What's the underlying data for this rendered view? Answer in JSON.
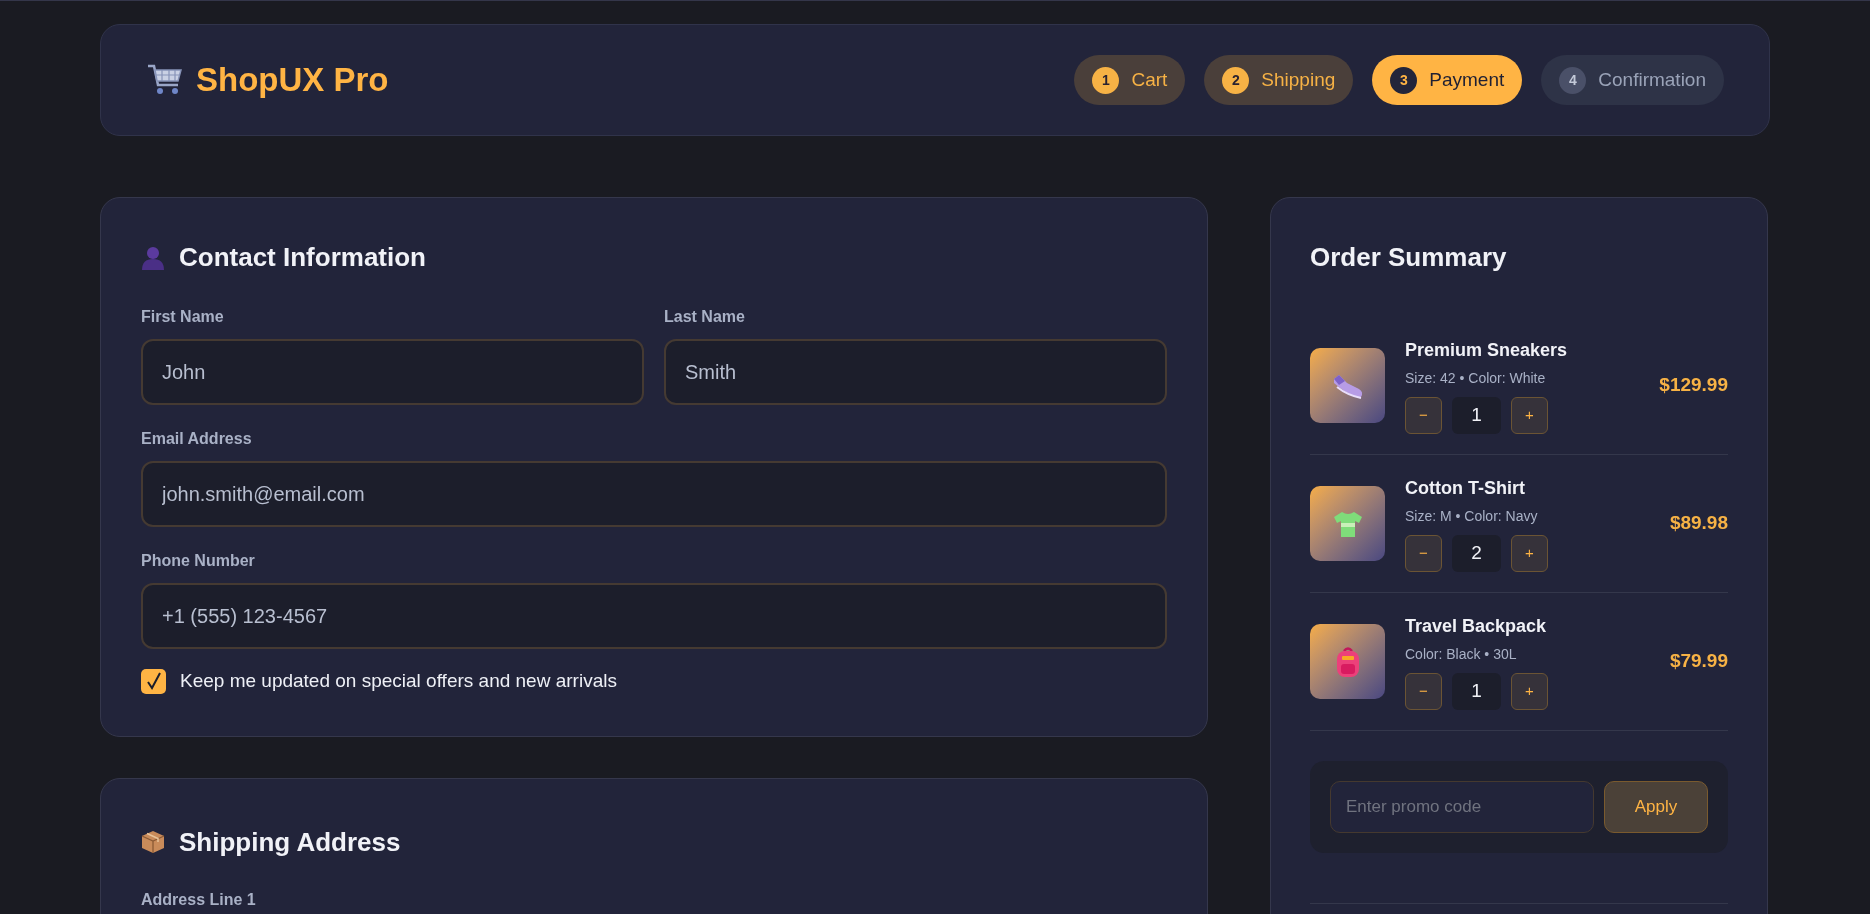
{
  "brand": {
    "name": "ShopUX Pro"
  },
  "steps": [
    {
      "number": "1",
      "label": "Cart",
      "kind": "done"
    },
    {
      "number": "2",
      "label": "Shipping",
      "kind": "done"
    },
    {
      "number": "3",
      "label": "Payment",
      "kind": "active"
    },
    {
      "number": "4",
      "label": "Confirmation",
      "kind": "pending"
    }
  ],
  "contact": {
    "title": "Contact Information",
    "fields": [
      {
        "label": "First Name",
        "value": "John",
        "kind": "half"
      },
      {
        "label": "Last Name",
        "value": "Smith",
        "kind": "half"
      },
      {
        "label": "Email Address",
        "value": "john.smith@email.com",
        "kind": "full"
      },
      {
        "label": "Phone Number",
        "value": "+1 (555) 123-4567",
        "kind": "full"
      }
    ],
    "newsletter": {
      "label": "Keep me updated on special offers and new arrivals",
      "checked": true
    }
  },
  "shipping": {
    "title": "Shipping Address",
    "fields": [
      {
        "label": "Address Line 1"
      }
    ]
  },
  "summary": {
    "title": "Order Summary",
    "items": [
      {
        "kind": "sneaker",
        "name": "Premium Sneakers",
        "meta": "Size: 42 • Color: White",
        "minus": "−",
        "quantity": "1",
        "plus": "+",
        "price": "$129.99"
      },
      {
        "kind": "tshirt",
        "name": "Cotton T-Shirt",
        "meta": "Size: M • Color: Navy",
        "minus": "−",
        "quantity": "2",
        "plus": "+",
        "price": "$89.98"
      },
      {
        "kind": "backpack",
        "name": "Travel Backpack",
        "meta": "Color: Black • 30L",
        "minus": "−",
        "quantity": "1",
        "plus": "+",
        "price": "$79.99"
      }
    ],
    "promo": {
      "placeholder": "Enter promo code",
      "button": "Apply"
    }
  }
}
